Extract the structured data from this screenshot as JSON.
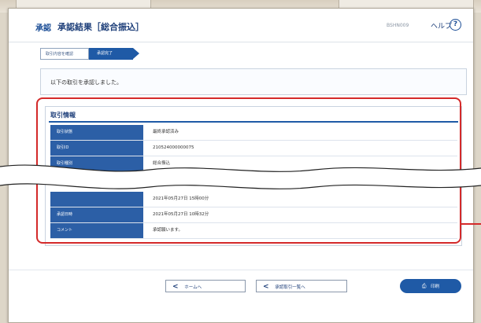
{
  "header": {
    "section": "承認",
    "title": "承認結果［総合振込］",
    "screen_id": "BSHN009",
    "help_label": "ヘルプ",
    "help_icon": "help-icon"
  },
  "steps": [
    "取引内容を確認",
    "承認完了"
  ],
  "message": "以下の取引を承認しました。",
  "transaction_info": {
    "title": "取引情報",
    "rows": [
      {
        "label": "取引状態",
        "value": "最終承認済み"
      },
      {
        "label": "取引ID",
        "value": "210524000000075"
      },
      {
        "label": "取引種別",
        "value": "総合振込"
      },
      {
        "label": "",
        "value": "2021年05月27日 15時00分"
      },
      {
        "label": "承認日時",
        "value": "2021年05月27日 10時32分"
      },
      {
        "label": "コメント",
        "value": "承認願います。"
      }
    ]
  },
  "buttons": {
    "home": "ホームへ",
    "list": "承認取引一覧へ",
    "print": "印刷"
  },
  "colors": {
    "accent": "#1f5aa6",
    "highlight": "#d42a2a"
  }
}
